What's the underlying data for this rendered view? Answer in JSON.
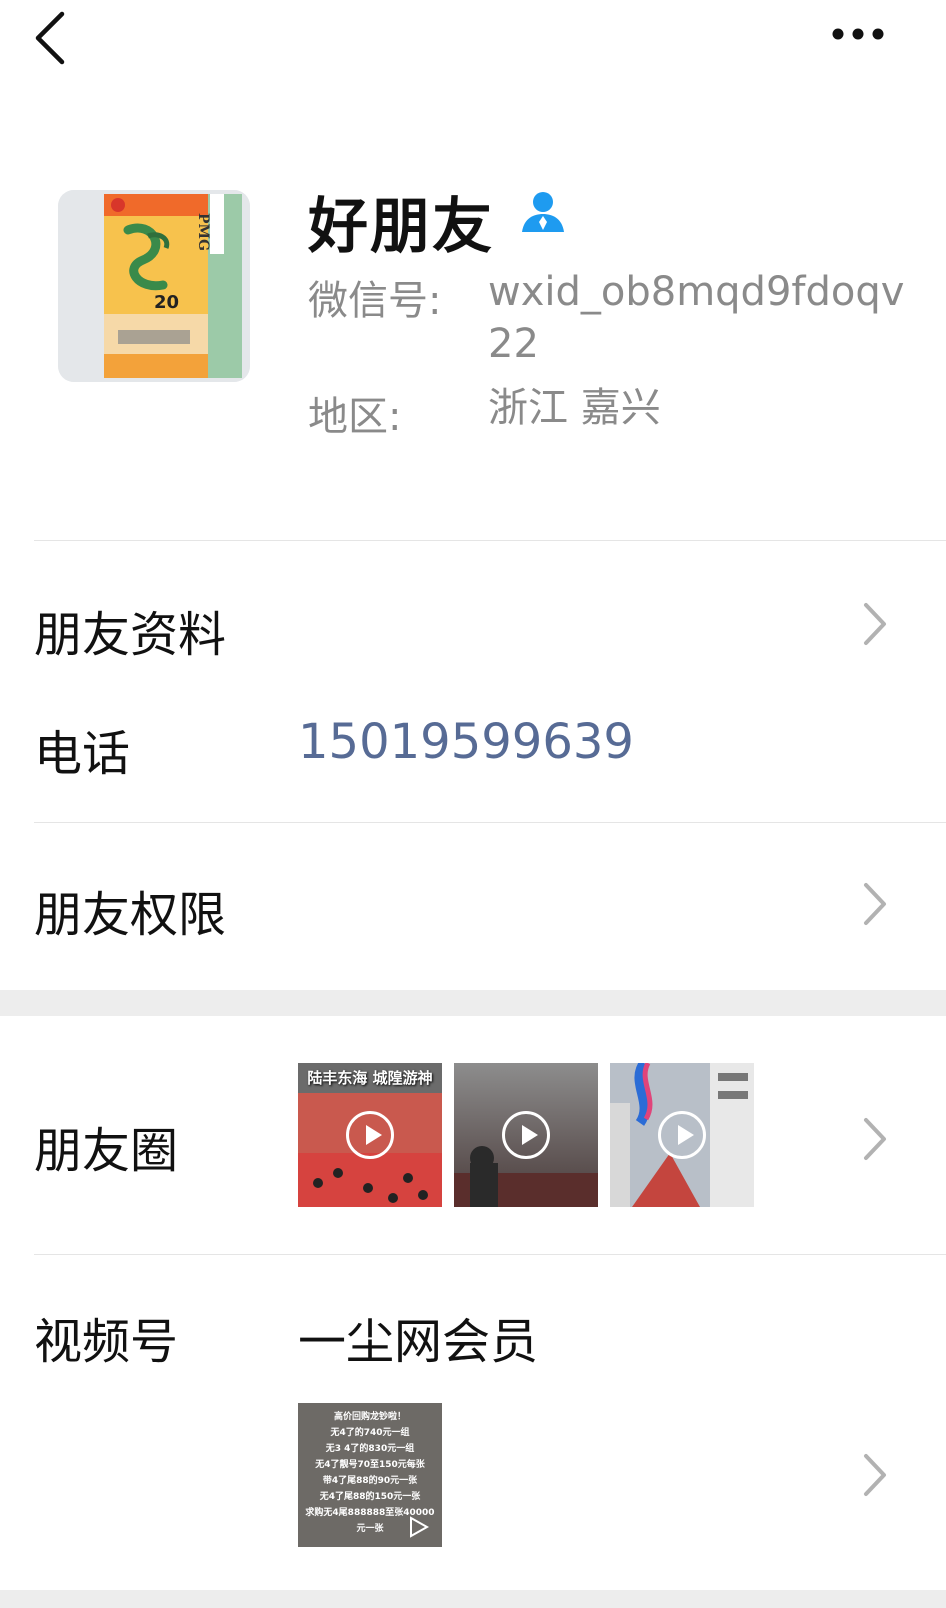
{
  "nav": {
    "back_icon": "chevron-left-icon",
    "more_icon": "more-horizontal-icon"
  },
  "profile": {
    "name": "好朋友",
    "gender_icon": "person-icon",
    "wechat_id_label": "微信号:",
    "wechat_id_value": "wxid_ob8mqd9fdoqv22",
    "region_label": "地区:",
    "region_value": "浙江 嘉兴",
    "avatar_text": [
      "PMG",
      "20"
    ]
  },
  "rows": {
    "friend_info": "朋友资料",
    "phone_label": "电话",
    "phone_value": "15019599639",
    "permissions": "朋友权限",
    "moments": "朋友圈",
    "channels": "视频号",
    "channel_name": "一尘网会员"
  },
  "moments_thumbs": [
    {
      "caption": "陆丰东海 城隍游神",
      "play_icon": "play-circle-icon"
    },
    {
      "caption": "",
      "play_icon": "play-circle-icon"
    },
    {
      "caption": "",
      "play_icon": "play-circle-icon"
    }
  ],
  "channel_thumb_lines": [
    "高价回购龙钞啦！",
    "无4了的740元一组",
    "无3 4了的830元一组",
    "无4了靓号70至150元每张",
    "带4了尾88的90元一张",
    "无4了尾88的150元一张",
    "求购无4尾888888至张40000",
    "元一张"
  ],
  "colors": {
    "link": "#576b95",
    "gray_text": "#8a8a8a",
    "gender_icon": "#1e9bf0",
    "divider": "#e5e5e5",
    "section_gap": "#ededed"
  }
}
